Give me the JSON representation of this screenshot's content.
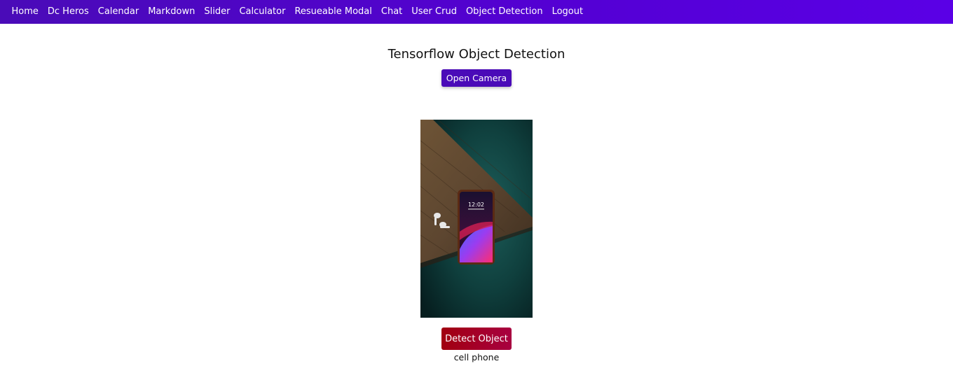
{
  "navbar": {
    "links": [
      "Home",
      "Dc Heros",
      "Calendar",
      "Markdown",
      "Slider",
      "Calculator",
      "Resueable Modal",
      "Chat",
      "User Crud",
      "Object Detection",
      "Logout"
    ],
    "colors": {
      "start": "#4a0bb8",
      "end": "#5a00e6"
    }
  },
  "page": {
    "title": "Tensorflow Object Detection",
    "open_camera_label": "Open Camera",
    "detect_label": "Detect Object",
    "result_label": "cell phone"
  },
  "image": {
    "phone_time": "12:02",
    "content": "smartphone-and-earbuds-on-wooden-table"
  },
  "colors": {
    "accent": "#4a0bb8",
    "detect": "#a10010"
  }
}
